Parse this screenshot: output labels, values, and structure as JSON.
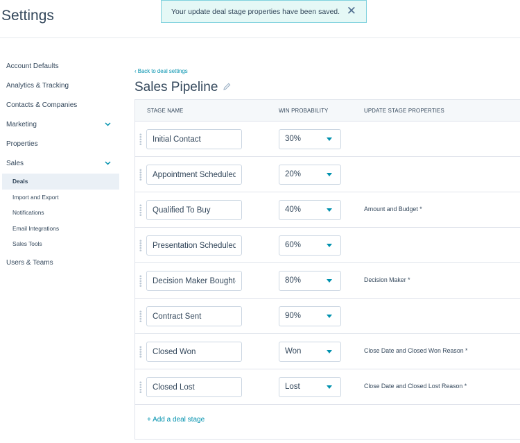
{
  "header": {
    "title": "Settings",
    "toast": {
      "message": "Your update deal stage properties have been saved.",
      "close": "✕"
    }
  },
  "sidebar": {
    "items": [
      {
        "label": "Account Defaults"
      },
      {
        "label": "Analytics & Tracking"
      },
      {
        "label": "Contacts & Companies"
      },
      {
        "label": "Marketing",
        "expandable": true
      },
      {
        "label": "Properties"
      },
      {
        "label": "Sales",
        "expandable": true
      }
    ],
    "sales_sub": [
      {
        "label": "Deals",
        "active": true
      },
      {
        "label": "Import and Export"
      },
      {
        "label": "Notifications"
      },
      {
        "label": "Email Integrations"
      },
      {
        "label": "Sales Tools"
      }
    ],
    "last_item": "Users & Teams"
  },
  "main": {
    "back_link": "‹ Back to deal settings",
    "title": "Sales Pipeline",
    "columns": {
      "stage": "STAGE NAME",
      "probability": "WIN PROBABILITY",
      "properties": "UPDATE STAGE PROPERTIES"
    },
    "stages": [
      {
        "name": "Initial Contact",
        "probability": "30%",
        "properties": ""
      },
      {
        "name": "Appointment Scheduled",
        "probability": "20%",
        "properties": ""
      },
      {
        "name": "Qualified To Buy",
        "probability": "40%",
        "properties": "Amount and Budget *"
      },
      {
        "name": "Presentation Scheduled",
        "probability": "60%",
        "properties": ""
      },
      {
        "name": "Decision Maker Bought-In",
        "probability": "80%",
        "properties": "Decision Maker *"
      },
      {
        "name": "Contract Sent",
        "probability": "90%",
        "properties": ""
      },
      {
        "name": "Closed Won",
        "probability": "Won",
        "properties": "Close Date and Closed Won Reason *"
      },
      {
        "name": "Closed Lost",
        "probability": "Lost",
        "properties": "Close Date and Closed Lost Reason *"
      }
    ],
    "add_stage": "+ Add a deal stage"
  },
  "colors": {
    "accent": "#0091ae",
    "text": "#33475b",
    "toast_bg": "#e5f8f6",
    "border": "#dfe3eb"
  }
}
